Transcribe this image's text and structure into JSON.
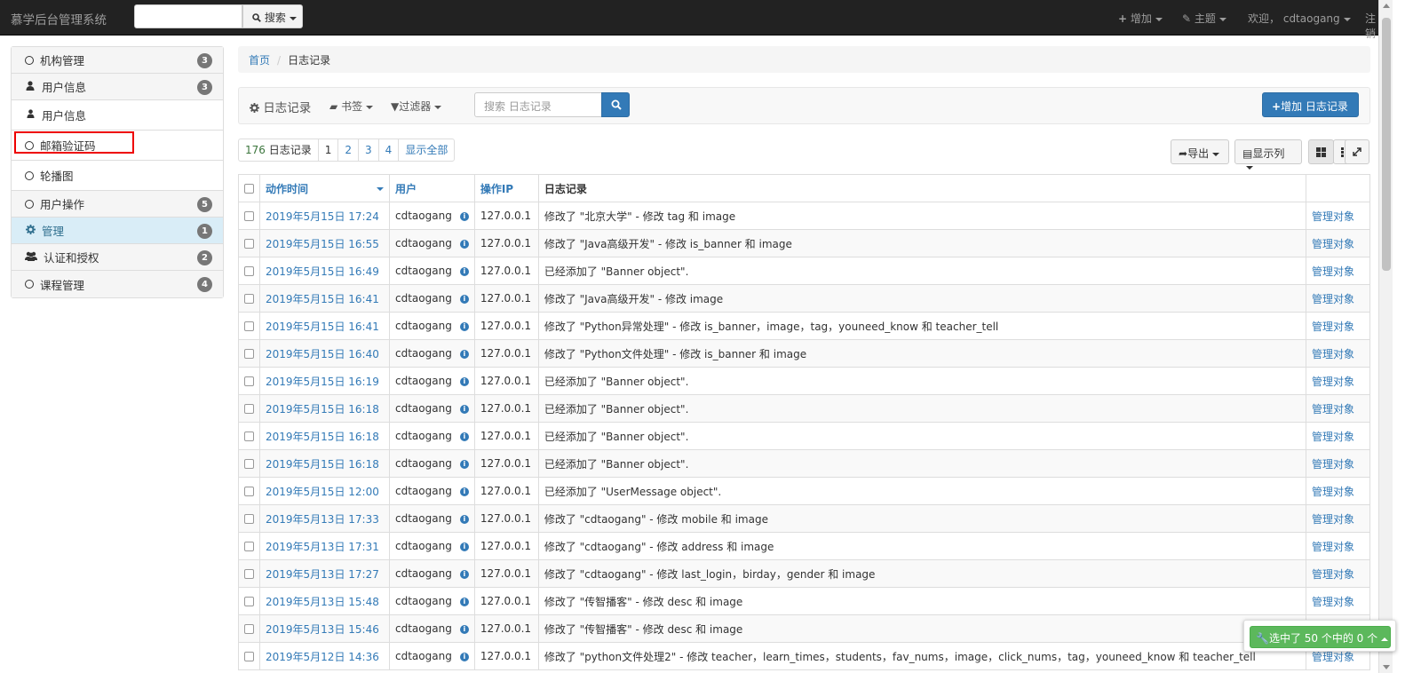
{
  "nav": {
    "brand": "慕学后台管理系统",
    "search_label": "搜索",
    "add_label": "增加",
    "theme_label": "主题",
    "welcome_label": "欢迎，",
    "user": "cdtaogang",
    "logout_label": "注销"
  },
  "sidebar": {
    "items": [
      {
        "label": "机构管理",
        "icon": "circle-icon",
        "badge": "3",
        "type": "group"
      },
      {
        "label": "用户信息",
        "icon": "user-icon",
        "badge": "3",
        "type": "group"
      },
      {
        "label": "用户信息",
        "icon": "user-icon",
        "type": "sub"
      },
      {
        "label": "邮箱验证码",
        "icon": "circle-icon",
        "type": "sub",
        "highlighted": true
      },
      {
        "label": "轮播图",
        "icon": "circle-icon",
        "type": "sub"
      },
      {
        "label": "用户操作",
        "icon": "circle-icon",
        "badge": "5",
        "type": "group"
      },
      {
        "label": "管理",
        "icon": "gear-icon",
        "badge": "1",
        "type": "group",
        "active": true
      },
      {
        "label": "认证和授权",
        "icon": "users-icon",
        "badge": "2",
        "type": "group"
      },
      {
        "label": "课程管理",
        "icon": "circle-icon",
        "badge": "4",
        "type": "group"
      }
    ]
  },
  "breadcrumb": {
    "home": "首页",
    "current": "日志记录"
  },
  "toolbar": {
    "title": "日志记录",
    "bookmarks": "书签",
    "filters": "过滤器",
    "search_placeholder": "搜索 日志记录",
    "add_button": "增加 日志记录"
  },
  "pagination": {
    "count": "176",
    "count_label": "日志记录",
    "pages": [
      "1",
      "2",
      "3",
      "4"
    ],
    "show_all": "显示全部"
  },
  "actions": {
    "export": "导出",
    "columns": "显示列"
  },
  "table": {
    "headers": [
      "动作时间",
      "用户",
      "操作IP",
      "日志记录"
    ],
    "rows": [
      {
        "time": "2019年5月15日 17:24",
        "user": "cdtaogang",
        "ip": "127.0.0.1",
        "message": "修改了 \"北京大学\" - 修改 tag 和 image",
        "link": "管理对象"
      },
      {
        "time": "2019年5月15日 16:55",
        "user": "cdtaogang",
        "ip": "127.0.0.1",
        "message": "修改了 \"Java高级开发\" - 修改 is_banner 和 image",
        "link": "管理对象"
      },
      {
        "time": "2019年5月15日 16:49",
        "user": "cdtaogang",
        "ip": "127.0.0.1",
        "message": "已经添加了 \"Banner object\".",
        "link": "管理对象"
      },
      {
        "time": "2019年5月15日 16:41",
        "user": "cdtaogang",
        "ip": "127.0.0.1",
        "message": "修改了 \"Java高级开发\" - 修改 image",
        "link": "管理对象"
      },
      {
        "time": "2019年5月15日 16:41",
        "user": "cdtaogang",
        "ip": "127.0.0.1",
        "message": "修改了 \"Python异常处理\" - 修改 is_banner，image，tag，youneed_know 和 teacher_tell",
        "link": "管理对象"
      },
      {
        "time": "2019年5月15日 16:40",
        "user": "cdtaogang",
        "ip": "127.0.0.1",
        "message": "修改了 \"Python文件处理\" - 修改 is_banner 和 image",
        "link": "管理对象"
      },
      {
        "time": "2019年5月15日 16:19",
        "user": "cdtaogang",
        "ip": "127.0.0.1",
        "message": "已经添加了 \"Banner object\".",
        "link": "管理对象"
      },
      {
        "time": "2019年5月15日 16:18",
        "user": "cdtaogang",
        "ip": "127.0.0.1",
        "message": "已经添加了 \"Banner object\".",
        "link": "管理对象"
      },
      {
        "time": "2019年5月15日 16:18",
        "user": "cdtaogang",
        "ip": "127.0.0.1",
        "message": "已经添加了 \"Banner object\".",
        "link": "管理对象"
      },
      {
        "time": "2019年5月15日 16:18",
        "user": "cdtaogang",
        "ip": "127.0.0.1",
        "message": "已经添加了 \"Banner object\".",
        "link": "管理对象"
      },
      {
        "time": "2019年5月15日 12:00",
        "user": "cdtaogang",
        "ip": "127.0.0.1",
        "message": "已经添加了 \"UserMessage object\".",
        "link": "管理对象"
      },
      {
        "time": "2019年5月13日 17:33",
        "user": "cdtaogang",
        "ip": "127.0.0.1",
        "message": "修改了 \"cdtaogang\" - 修改 mobile 和 image",
        "link": "管理对象"
      },
      {
        "time": "2019年5月13日 17:31",
        "user": "cdtaogang",
        "ip": "127.0.0.1",
        "message": "修改了 \"cdtaogang\" - 修改 address 和 image",
        "link": "管理对象"
      },
      {
        "time": "2019年5月13日 17:27",
        "user": "cdtaogang",
        "ip": "127.0.0.1",
        "message": "修改了 \"cdtaogang\" - 修改 last_login，birday，gender 和 image",
        "link": "管理对象"
      },
      {
        "time": "2019年5月13日 15:48",
        "user": "cdtaogang",
        "ip": "127.0.0.1",
        "message": "修改了 \"传智播客\" - 修改 desc 和 image",
        "link": "管理对象"
      },
      {
        "time": "2019年5月13日 15:46",
        "user": "cdtaogang",
        "ip": "127.0.0.1",
        "message": "修改了 \"传智播客\" - 修改 desc 和 image",
        "link": "管理对象"
      },
      {
        "time": "2019年5月12日 14:36",
        "user": "cdtaogang",
        "ip": "127.0.0.1",
        "message": "修改了 \"python文件处理2\" - 修改 teacher，learn_times，students，fav_nums，image，click_nums，tag，youneed_know 和 teacher_tell",
        "link": "管理对象"
      }
    ]
  },
  "selection": {
    "label": "选中了 50 个中的 0 个"
  },
  "colors": {
    "navbar": "#222222",
    "link": "#337ab7",
    "primary": "#337ab7",
    "success": "#5cb85c",
    "active_bg": "#d9edf7",
    "highlight": "#e00000"
  }
}
